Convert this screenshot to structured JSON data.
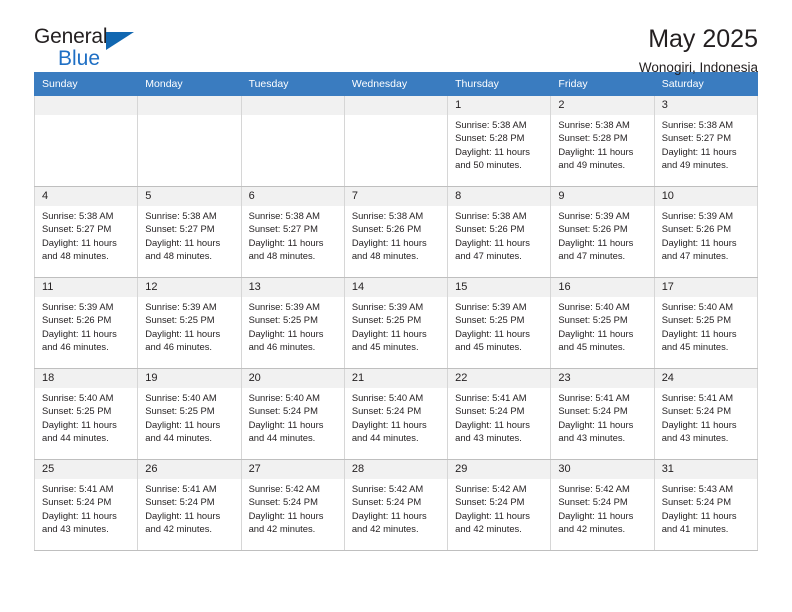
{
  "brand": {
    "word1": "General",
    "word2": "Blue",
    "logo_icon": "blue-triangle-logo"
  },
  "header": {
    "title": "May 2025",
    "subtitle": "Wonogiri, Indonesia"
  },
  "calendar": {
    "weekday_headers": [
      "Sunday",
      "Monday",
      "Tuesday",
      "Wednesday",
      "Thursday",
      "Friday",
      "Saturday"
    ],
    "header_bg": "#3a7cc0",
    "daynum_bg": "#f1f1f1",
    "weeks": [
      [
        {
          "day": "",
          "sunrise": "",
          "sunset": "",
          "daylight_line1": "",
          "daylight_line2": ""
        },
        {
          "day": "",
          "sunrise": "",
          "sunset": "",
          "daylight_line1": "",
          "daylight_line2": ""
        },
        {
          "day": "",
          "sunrise": "",
          "sunset": "",
          "daylight_line1": "",
          "daylight_line2": ""
        },
        {
          "day": "",
          "sunrise": "",
          "sunset": "",
          "daylight_line1": "",
          "daylight_line2": ""
        },
        {
          "day": "1",
          "sunrise": "Sunrise: 5:38 AM",
          "sunset": "Sunset: 5:28 PM",
          "daylight_line1": "Daylight: 11 hours",
          "daylight_line2": "and 50 minutes."
        },
        {
          "day": "2",
          "sunrise": "Sunrise: 5:38 AM",
          "sunset": "Sunset: 5:28 PM",
          "daylight_line1": "Daylight: 11 hours",
          "daylight_line2": "and 49 minutes."
        },
        {
          "day": "3",
          "sunrise": "Sunrise: 5:38 AM",
          "sunset": "Sunset: 5:27 PM",
          "daylight_line1": "Daylight: 11 hours",
          "daylight_line2": "and 49 minutes."
        }
      ],
      [
        {
          "day": "4",
          "sunrise": "Sunrise: 5:38 AM",
          "sunset": "Sunset: 5:27 PM",
          "daylight_line1": "Daylight: 11 hours",
          "daylight_line2": "and 48 minutes."
        },
        {
          "day": "5",
          "sunrise": "Sunrise: 5:38 AM",
          "sunset": "Sunset: 5:27 PM",
          "daylight_line1": "Daylight: 11 hours",
          "daylight_line2": "and 48 minutes."
        },
        {
          "day": "6",
          "sunrise": "Sunrise: 5:38 AM",
          "sunset": "Sunset: 5:27 PM",
          "daylight_line1": "Daylight: 11 hours",
          "daylight_line2": "and 48 minutes."
        },
        {
          "day": "7",
          "sunrise": "Sunrise: 5:38 AM",
          "sunset": "Sunset: 5:26 PM",
          "daylight_line1": "Daylight: 11 hours",
          "daylight_line2": "and 48 minutes."
        },
        {
          "day": "8",
          "sunrise": "Sunrise: 5:38 AM",
          "sunset": "Sunset: 5:26 PM",
          "daylight_line1": "Daylight: 11 hours",
          "daylight_line2": "and 47 minutes."
        },
        {
          "day": "9",
          "sunrise": "Sunrise: 5:39 AM",
          "sunset": "Sunset: 5:26 PM",
          "daylight_line1": "Daylight: 11 hours",
          "daylight_line2": "and 47 minutes."
        },
        {
          "day": "10",
          "sunrise": "Sunrise: 5:39 AM",
          "sunset": "Sunset: 5:26 PM",
          "daylight_line1": "Daylight: 11 hours",
          "daylight_line2": "and 47 minutes."
        }
      ],
      [
        {
          "day": "11",
          "sunrise": "Sunrise: 5:39 AM",
          "sunset": "Sunset: 5:26 PM",
          "daylight_line1": "Daylight: 11 hours",
          "daylight_line2": "and 46 minutes."
        },
        {
          "day": "12",
          "sunrise": "Sunrise: 5:39 AM",
          "sunset": "Sunset: 5:25 PM",
          "daylight_line1": "Daylight: 11 hours",
          "daylight_line2": "and 46 minutes."
        },
        {
          "day": "13",
          "sunrise": "Sunrise: 5:39 AM",
          "sunset": "Sunset: 5:25 PM",
          "daylight_line1": "Daylight: 11 hours",
          "daylight_line2": "and 46 minutes."
        },
        {
          "day": "14",
          "sunrise": "Sunrise: 5:39 AM",
          "sunset": "Sunset: 5:25 PM",
          "daylight_line1": "Daylight: 11 hours",
          "daylight_line2": "and 45 minutes."
        },
        {
          "day": "15",
          "sunrise": "Sunrise: 5:39 AM",
          "sunset": "Sunset: 5:25 PM",
          "daylight_line1": "Daylight: 11 hours",
          "daylight_line2": "and 45 minutes."
        },
        {
          "day": "16",
          "sunrise": "Sunrise: 5:40 AM",
          "sunset": "Sunset: 5:25 PM",
          "daylight_line1": "Daylight: 11 hours",
          "daylight_line2": "and 45 minutes."
        },
        {
          "day": "17",
          "sunrise": "Sunrise: 5:40 AM",
          "sunset": "Sunset: 5:25 PM",
          "daylight_line1": "Daylight: 11 hours",
          "daylight_line2": "and 45 minutes."
        }
      ],
      [
        {
          "day": "18",
          "sunrise": "Sunrise: 5:40 AM",
          "sunset": "Sunset: 5:25 PM",
          "daylight_line1": "Daylight: 11 hours",
          "daylight_line2": "and 44 minutes."
        },
        {
          "day": "19",
          "sunrise": "Sunrise: 5:40 AM",
          "sunset": "Sunset: 5:25 PM",
          "daylight_line1": "Daylight: 11 hours",
          "daylight_line2": "and 44 minutes."
        },
        {
          "day": "20",
          "sunrise": "Sunrise: 5:40 AM",
          "sunset": "Sunset: 5:24 PM",
          "daylight_line1": "Daylight: 11 hours",
          "daylight_line2": "and 44 minutes."
        },
        {
          "day": "21",
          "sunrise": "Sunrise: 5:40 AM",
          "sunset": "Sunset: 5:24 PM",
          "daylight_line1": "Daylight: 11 hours",
          "daylight_line2": "and 44 minutes."
        },
        {
          "day": "22",
          "sunrise": "Sunrise: 5:41 AM",
          "sunset": "Sunset: 5:24 PM",
          "daylight_line1": "Daylight: 11 hours",
          "daylight_line2": "and 43 minutes."
        },
        {
          "day": "23",
          "sunrise": "Sunrise: 5:41 AM",
          "sunset": "Sunset: 5:24 PM",
          "daylight_line1": "Daylight: 11 hours",
          "daylight_line2": "and 43 minutes."
        },
        {
          "day": "24",
          "sunrise": "Sunrise: 5:41 AM",
          "sunset": "Sunset: 5:24 PM",
          "daylight_line1": "Daylight: 11 hours",
          "daylight_line2": "and 43 minutes."
        }
      ],
      [
        {
          "day": "25",
          "sunrise": "Sunrise: 5:41 AM",
          "sunset": "Sunset: 5:24 PM",
          "daylight_line1": "Daylight: 11 hours",
          "daylight_line2": "and 43 minutes."
        },
        {
          "day": "26",
          "sunrise": "Sunrise: 5:41 AM",
          "sunset": "Sunset: 5:24 PM",
          "daylight_line1": "Daylight: 11 hours",
          "daylight_line2": "and 42 minutes."
        },
        {
          "day": "27",
          "sunrise": "Sunrise: 5:42 AM",
          "sunset": "Sunset: 5:24 PM",
          "daylight_line1": "Daylight: 11 hours",
          "daylight_line2": "and 42 minutes."
        },
        {
          "day": "28",
          "sunrise": "Sunrise: 5:42 AM",
          "sunset": "Sunset: 5:24 PM",
          "daylight_line1": "Daylight: 11 hours",
          "daylight_line2": "and 42 minutes."
        },
        {
          "day": "29",
          "sunrise": "Sunrise: 5:42 AM",
          "sunset": "Sunset: 5:24 PM",
          "daylight_line1": "Daylight: 11 hours",
          "daylight_line2": "and 42 minutes."
        },
        {
          "day": "30",
          "sunrise": "Sunrise: 5:42 AM",
          "sunset": "Sunset: 5:24 PM",
          "daylight_line1": "Daylight: 11 hours",
          "daylight_line2": "and 42 minutes."
        },
        {
          "day": "31",
          "sunrise": "Sunrise: 5:43 AM",
          "sunset": "Sunset: 5:24 PM",
          "daylight_line1": "Daylight: 11 hours",
          "daylight_line2": "and 41 minutes."
        }
      ]
    ]
  }
}
